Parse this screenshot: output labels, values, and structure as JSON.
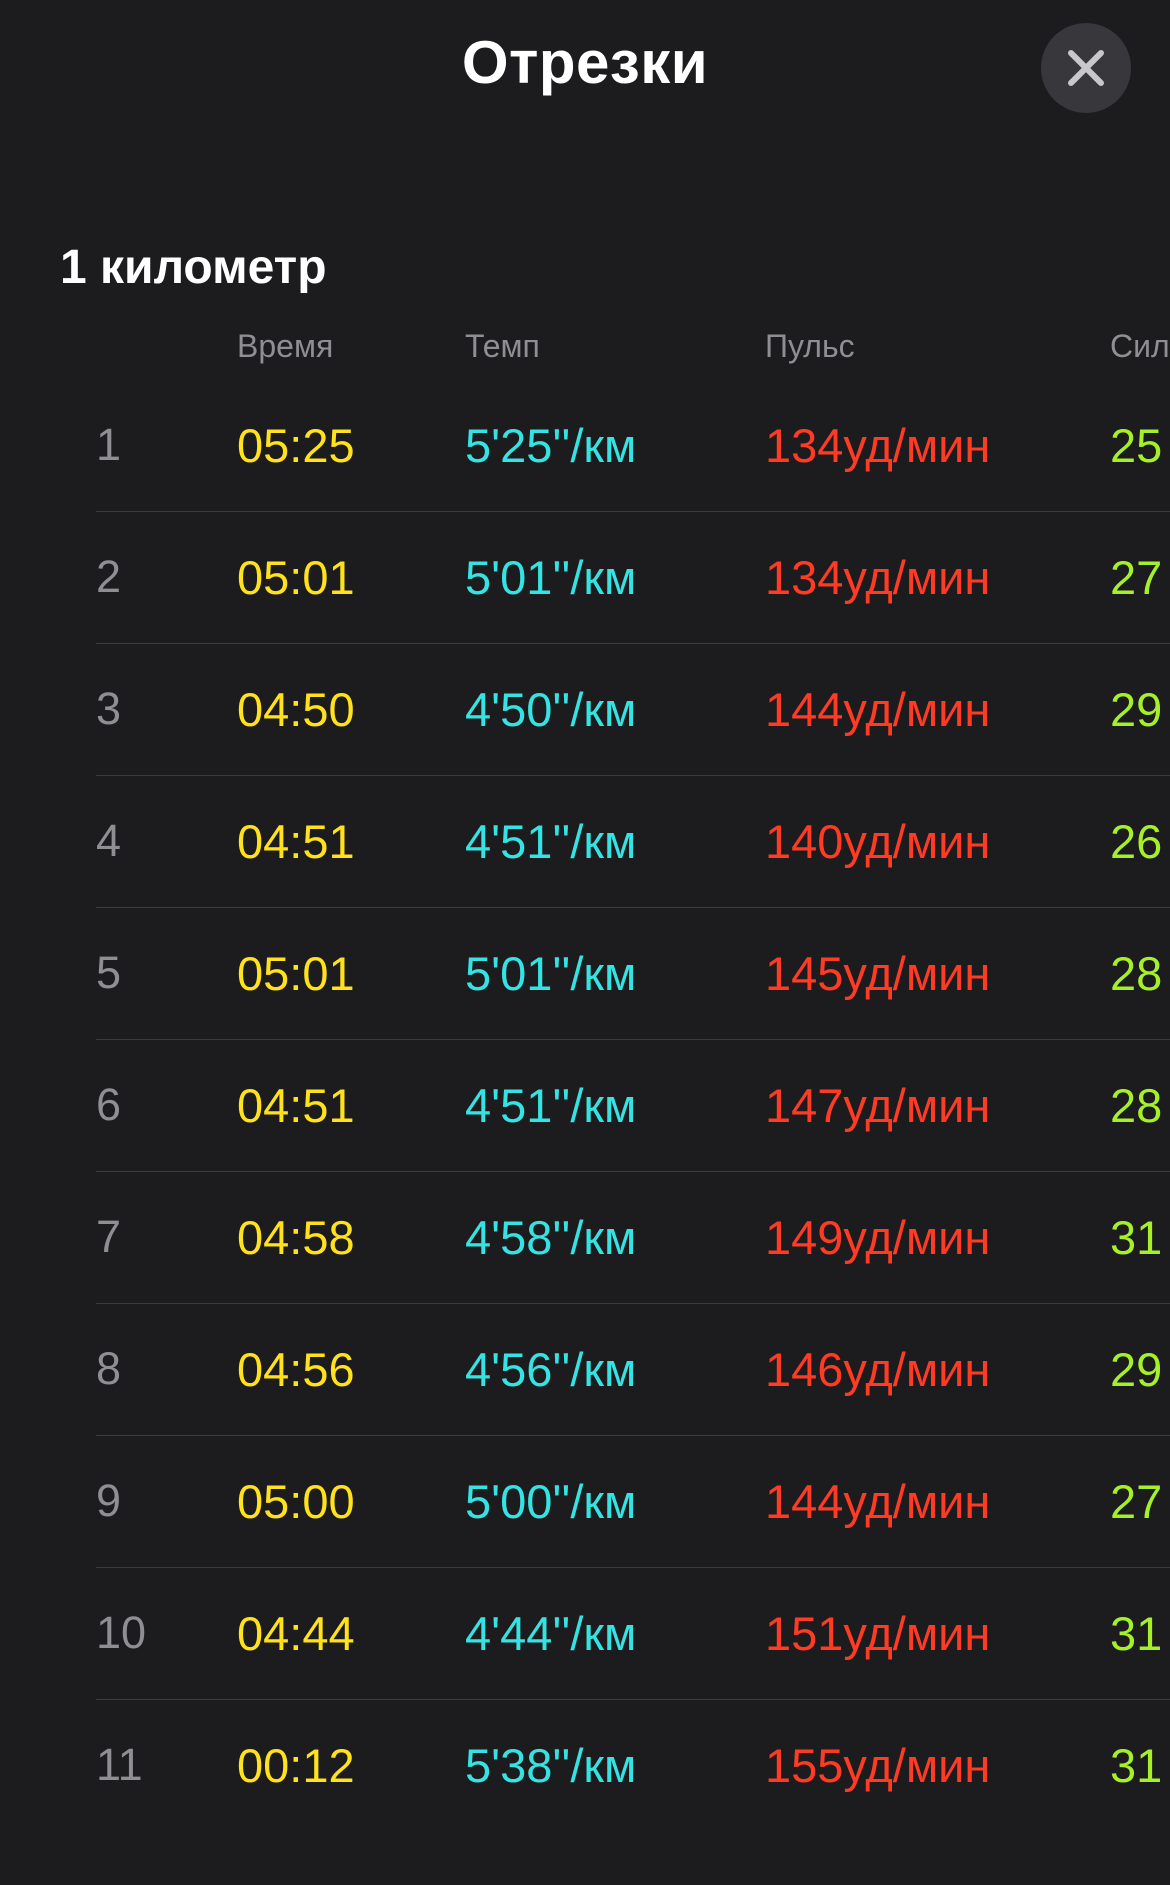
{
  "header": {
    "title": "Отрезки",
    "close_icon": "close-icon"
  },
  "section": {
    "title": "1 километр"
  },
  "columns": {
    "time": "Время",
    "pace": "Темп",
    "heart_rate": "Пульс",
    "power": "Сил"
  },
  "colors": {
    "time": "#ffe11c",
    "pace": "#35e3e3",
    "heart_rate": "#ff3b24",
    "power": "#a6f02a",
    "index": "#8e8e93",
    "background": "#1c1c1e"
  },
  "splits": [
    {
      "index": "1",
      "time": "05:25",
      "pace": "5'25''/км",
      "heart_rate": "134уд/мин",
      "power": "25"
    },
    {
      "index": "2",
      "time": "05:01",
      "pace": "5'01''/км",
      "heart_rate": "134уд/мин",
      "power": "27"
    },
    {
      "index": "3",
      "time": "04:50",
      "pace": "4'50''/км",
      "heart_rate": "144уд/мин",
      "power": "29"
    },
    {
      "index": "4",
      "time": "04:51",
      "pace": "4'51''/км",
      "heart_rate": "140уд/мин",
      "power": "26"
    },
    {
      "index": "5",
      "time": "05:01",
      "pace": "5'01''/км",
      "heart_rate": "145уд/мин",
      "power": "28"
    },
    {
      "index": "6",
      "time": "04:51",
      "pace": "4'51''/км",
      "heart_rate": "147уд/мин",
      "power": "28"
    },
    {
      "index": "7",
      "time": "04:58",
      "pace": "4'58''/км",
      "heart_rate": "149уд/мин",
      "power": "31"
    },
    {
      "index": "8",
      "time": "04:56",
      "pace": "4'56''/км",
      "heart_rate": "146уд/мин",
      "power": "29"
    },
    {
      "index": "9",
      "time": "05:00",
      "pace": "5'00''/км",
      "heart_rate": "144уд/мин",
      "power": "27"
    },
    {
      "index": "10",
      "time": "04:44",
      "pace": "4'44''/км",
      "heart_rate": "151уд/мин",
      "power": "31"
    },
    {
      "index": "11",
      "time": "00:12",
      "pace": "5'38''/км",
      "heart_rate": "155уд/мин",
      "power": "31"
    }
  ]
}
